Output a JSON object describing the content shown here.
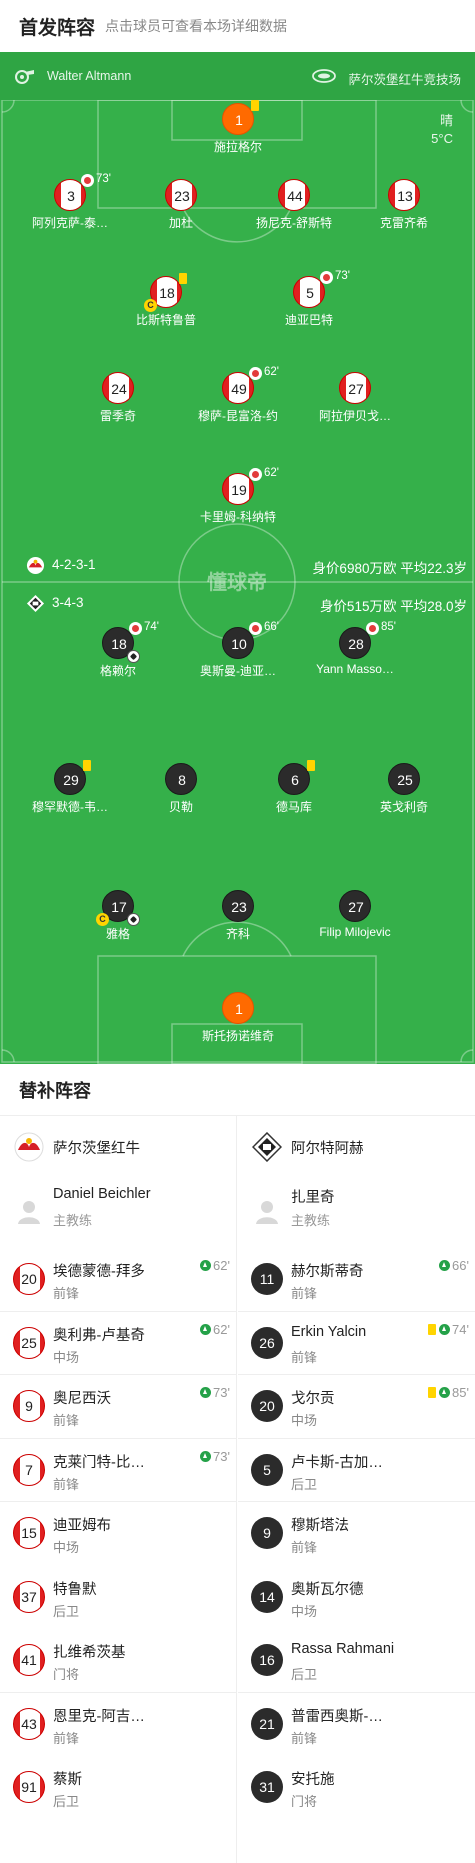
{
  "header": {
    "title": "首发阵容",
    "subtitle": "点击球员可查看本场详细数据"
  },
  "match_info": {
    "referee": "Walter Altmann",
    "stadium": "萨尔茨堡红牛竞技场",
    "weather": "晴",
    "temperature": "5°C"
  },
  "home_team": {
    "formation": "4-2-3-1",
    "value_info": "身价6980万欧  平均22.3岁",
    "goalkeeper": {
      "number": "1",
      "name": "施拉格尔"
    },
    "defenders": [
      {
        "number": "3",
        "name": "阿列克萨-泰…",
        "sub_minute": "73'"
      },
      {
        "number": "23",
        "name": "加杜"
      },
      {
        "number": "44",
        "name": "扬尼克-舒斯特"
      },
      {
        "number": "13",
        "name": "克雷齐希"
      }
    ],
    "midfield": [
      {
        "number": "18",
        "name": "比斯特鲁普"
      },
      {
        "number": "5",
        "name": "迪亚巴特",
        "sub_minute": "73'"
      }
    ],
    "attacking_mid": [
      {
        "number": "24",
        "name": "雷季奇"
      },
      {
        "number": "49",
        "name": "穆萨-昆富洛-约",
        "sub_minute": "62'"
      },
      {
        "number": "27",
        "name": "阿拉伊贝戈…"
      }
    ],
    "forward": {
      "number": "19",
      "name": "卡里姆-科纳特",
      "sub_minute": "62'"
    }
  },
  "away_team": {
    "formation": "3-4-3",
    "value_info": "身价515万欧   平均28.0岁",
    "forwards": [
      {
        "number": "18",
        "name": "格赖尔",
        "sub_minute": "74'"
      },
      {
        "number": "10",
        "name": "奥斯曼-迪亚…",
        "sub_minute": "66'"
      },
      {
        "number": "28",
        "name": "Yann Masso…",
        "sub_minute": "85'"
      }
    ],
    "midfield": [
      {
        "number": "29",
        "name": "穆罕默德-韦…"
      },
      {
        "number": "8",
        "name": "贝勒"
      },
      {
        "number": "6",
        "name": "德马库"
      },
      {
        "number": "25",
        "name": "英戈利奇"
      }
    ],
    "defenders": [
      {
        "number": "17",
        "name": "雅格"
      },
      {
        "number": "23",
        "name": "齐科"
      },
      {
        "number": "27",
        "name": "Filip Milojevic"
      }
    ],
    "goalkeeper": {
      "number": "1",
      "name": "斯托扬诺维奇"
    }
  },
  "pitch_watermark": "懂球帝",
  "captain_mark": "C",
  "subs": {
    "title": "替补阵容",
    "home": {
      "team_name": "萨尔茨堡红牛",
      "coach_name": "Daniel Beichler",
      "coach_role": "主教练",
      "players": [
        {
          "number": "20",
          "name": "埃德蒙德-拜多",
          "pos": "前锋",
          "minute": "62'"
        },
        {
          "number": "25",
          "name": "奥利弗-卢基奇",
          "pos": "中场",
          "minute": "62'"
        },
        {
          "number": "9",
          "name": "奥尼西沃",
          "pos": "前锋",
          "minute": "73'"
        },
        {
          "number": "7",
          "name": "克莱门特-比…",
          "pos": "前锋",
          "minute": "73'"
        },
        {
          "number": "15",
          "name": "迪亚姆布",
          "pos": "中场"
        },
        {
          "number": "37",
          "name": "特鲁默",
          "pos": "后卫"
        },
        {
          "number": "41",
          "name": "扎维希茨基",
          "pos": "门将"
        },
        {
          "number": "43",
          "name": "恩里克-阿吉…",
          "pos": "前锋"
        },
        {
          "number": "91",
          "name": "蔡斯",
          "pos": "后卫"
        }
      ]
    },
    "away": {
      "team_name": "阿尔特阿赫",
      "coach_name": "扎里奇",
      "coach_role": "主教练",
      "players": [
        {
          "number": "11",
          "name": "赫尔斯蒂奇",
          "pos": "前锋",
          "minute": "66'"
        },
        {
          "number": "26",
          "name": "Erkin Yalcin",
          "pos": "前锋",
          "minute": "74'"
        },
        {
          "number": "20",
          "name": "戈尔贡",
          "pos": "中场",
          "minute": "85'"
        },
        {
          "number": "5",
          "name": "卢卡斯-古加…",
          "pos": "后卫"
        },
        {
          "number": "9",
          "name": "穆斯塔法",
          "pos": "前锋"
        },
        {
          "number": "14",
          "name": "奥斯瓦尔德",
          "pos": "中场"
        },
        {
          "number": "16",
          "name": "Rassa Rahmani",
          "pos": "后卫"
        },
        {
          "number": "21",
          "name": "普雷西奥斯-…",
          "pos": "前锋"
        },
        {
          "number": "31",
          "name": "安托施",
          "pos": "门将"
        }
      ]
    }
  }
}
